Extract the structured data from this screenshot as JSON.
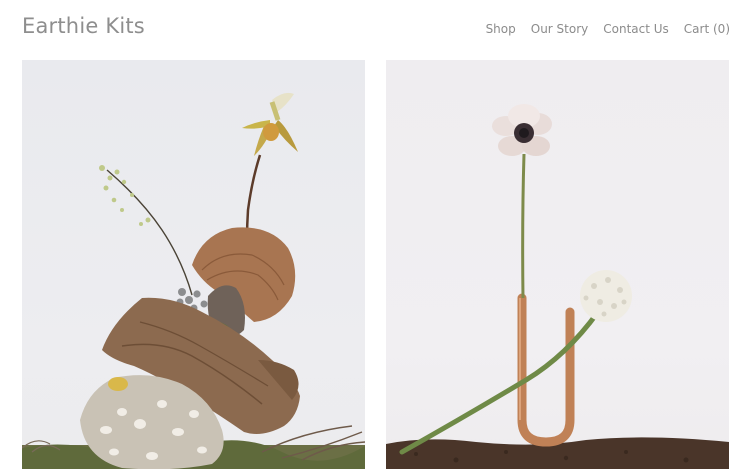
{
  "site": {
    "logo": "Earthie Kits"
  },
  "nav": {
    "items": [
      {
        "label": "Shop"
      },
      {
        "label": "Our Story"
      },
      {
        "label": "Contact Us"
      }
    ],
    "cart": {
      "label": "Cart",
      "count_text": "(0)"
    }
  },
  "gallery": {
    "tiles": [
      {
        "name": "orchid-driftwood-arrangement",
        "icon": "product-photo"
      },
      {
        "name": "anemone-copper-vase-arrangement",
        "icon": "product-photo"
      }
    ]
  },
  "colors": {
    "text": "#8e8e8e",
    "background": "#ffffff"
  }
}
